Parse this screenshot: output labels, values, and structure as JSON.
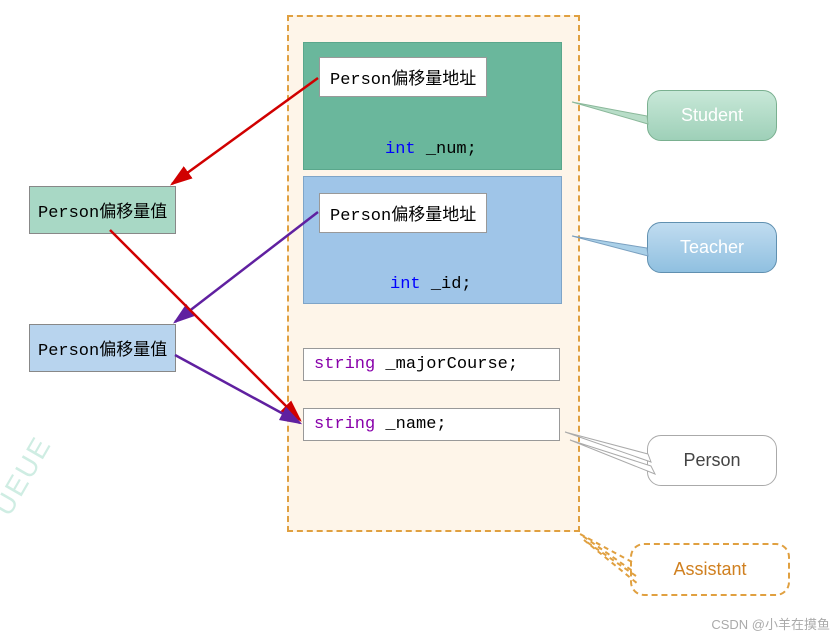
{
  "blocks": {
    "student_addr": "Person偏移量地址",
    "student_field_type": "int",
    "student_field_name": "_num;",
    "teacher_addr": "Person偏移量地址",
    "teacher_field_type": "int",
    "teacher_field_name": "_id;",
    "major_type": "string",
    "major_name": "_majorCourse;",
    "name_type": "string",
    "name_name": "_name;"
  },
  "vals": {
    "green": "Person偏移量值",
    "blue": "Person偏移量值"
  },
  "labels": {
    "student": "Student",
    "teacher": "Teacher",
    "person": "Person",
    "assistant": "Assistant"
  },
  "watermark": "CSDN @小羊在摸鱼",
  "side_watermark": "UEUE"
}
